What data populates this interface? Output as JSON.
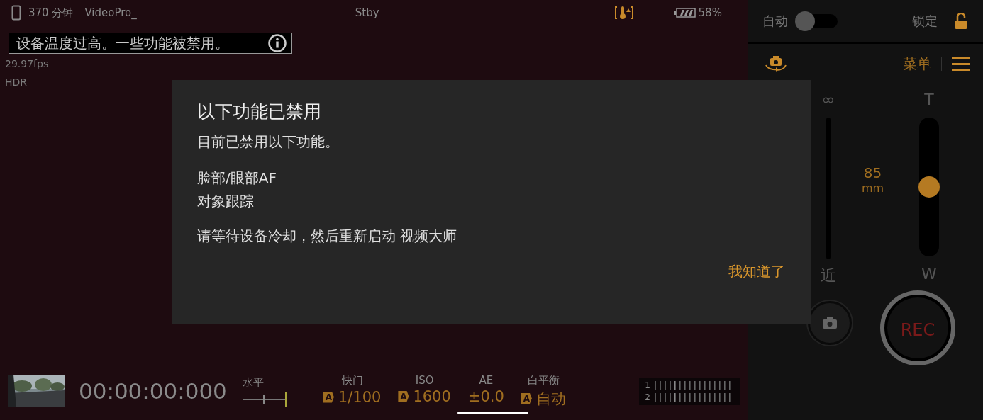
{
  "status_bar": {
    "remaining": "370 分钟",
    "file_name": "VideoPro_",
    "mode": "Stby",
    "battery": "58%"
  },
  "info": [
    "29.97fps",
    "HDR"
  ],
  "warning_banner": {
    "text": "设备温度过高。一些功能被禁用。"
  },
  "dialog": {
    "title": "以下功能已禁用",
    "message": "目前已禁用以下功能。",
    "features": [
      "脸部/眼部AF",
      "对象跟踪"
    ],
    "note": "请等待设备冷却，然后重新启动 视频大师",
    "button": "我知道了"
  },
  "bottom_bar": {
    "timecode": "00:00:00:000",
    "level_label": "水平",
    "settings": [
      {
        "label": "快门",
        "value": "1/100",
        "badge": "A"
      },
      {
        "label": "ISO",
        "value": "1600",
        "badge": "A"
      },
      {
        "label": "AE",
        "value": "±0.0"
      },
      {
        "label": "白平衡",
        "value": "自动",
        "badge": "A"
      }
    ],
    "audio_channels": [
      "1",
      "2"
    ]
  },
  "side_panel": {
    "auto_label": "自动",
    "auto_on": false,
    "lock_label": "锁定",
    "menu_label": "菜单",
    "focus": {
      "top": "∞",
      "bottom": "近"
    },
    "zoom": {
      "top": "T",
      "bottom": "W",
      "value": "85",
      "unit": "mm",
      "level": 0.5
    },
    "rec_label": "REC"
  }
}
